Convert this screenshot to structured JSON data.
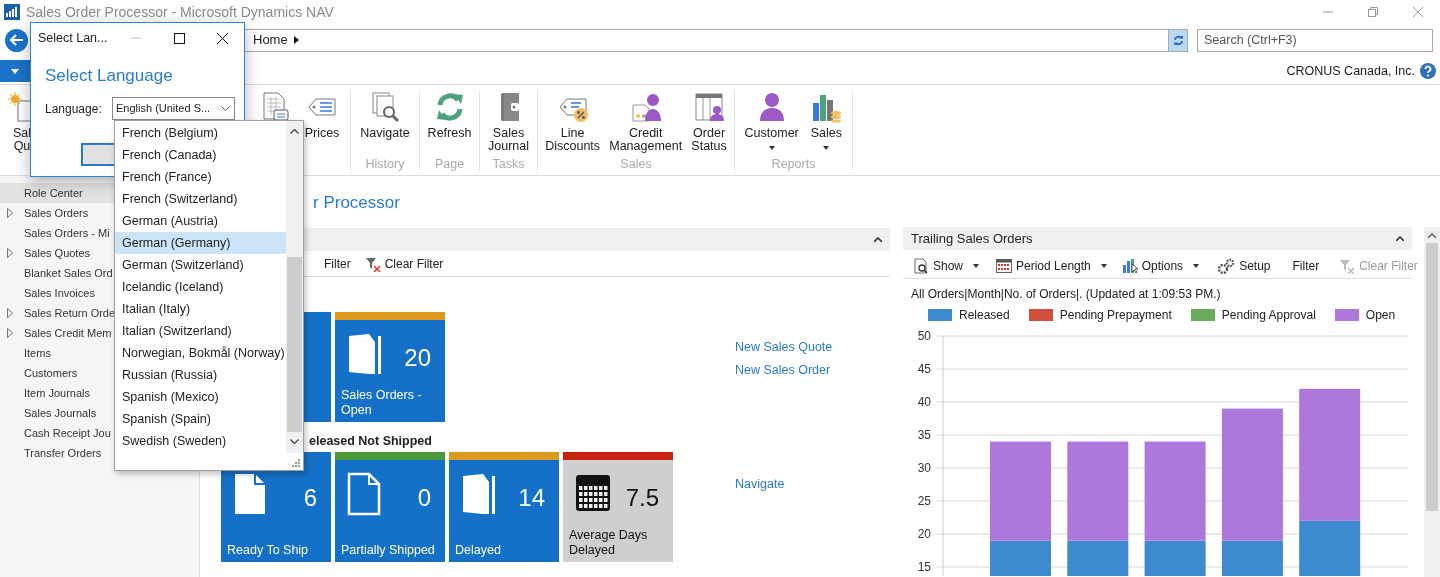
{
  "window": {
    "title": "Sales Order Processor - Microsoft Dynamics NAV"
  },
  "address_bar": {
    "breadcrumb": "Home",
    "search": {
      "placeholder": "Search (Ctrl+F3)"
    }
  },
  "company": "CRONUS Canada, Inc.",
  "ribbon": {
    "groups": [
      {
        "items": [
          {
            "label": "Sal Qu",
            "dropdown": false
          },
          {
            "dropdown": false
          },
          {
            "label": "Prices",
            "dropdown": false
          }
        ]
      },
      {
        "label": "History",
        "items": [
          {
            "label": "Navigate",
            "dropdown": false
          }
        ]
      },
      {
        "label": "Page",
        "items": [
          {
            "label": "Refresh",
            "dropdown": false
          }
        ]
      },
      {
        "label": "Tasks",
        "items": [
          {
            "label": "Sales Journal",
            "dropdown": false
          }
        ]
      },
      {
        "label": "Sales",
        "items": [
          {
            "label": "Line Discounts",
            "dropdown": false
          },
          {
            "label": "Credit Management",
            "dropdown": false
          },
          {
            "label": "Order Status",
            "dropdown": false
          }
        ]
      },
      {
        "label": "Reports",
        "items": [
          {
            "label": "Customer",
            "dropdown": true
          },
          {
            "label": "Sales",
            "dropdown": true
          }
        ]
      }
    ]
  },
  "sidebar": {
    "items": [
      {
        "label": "Role Center",
        "expandable": false,
        "selected": true
      },
      {
        "label": "Sales Orders",
        "expandable": true,
        "selected": false
      },
      {
        "label": "Sales Orders - Mi",
        "expandable": false,
        "selected": false
      },
      {
        "label": "Sales Quotes",
        "expandable": true,
        "selected": false
      },
      {
        "label": "Blanket Sales Ord",
        "expandable": false,
        "selected": false
      },
      {
        "label": "Sales Invoices",
        "expandable": false,
        "selected": false
      },
      {
        "label": "Sales Return Orde",
        "expandable": true,
        "selected": false
      },
      {
        "label": "Sales Credit Mem",
        "expandable": true,
        "selected": false
      },
      {
        "label": "Items",
        "expandable": false,
        "selected": false
      },
      {
        "label": "Customers",
        "expandable": false,
        "selected": false
      },
      {
        "label": "Item Journals",
        "expandable": false,
        "selected": false
      },
      {
        "label": "Sales Journals",
        "expandable": false,
        "selected": false
      },
      {
        "label": "Cash Receipt Jou",
        "expandable": false,
        "selected": false
      },
      {
        "label": "Transfer Orders",
        "expandable": false,
        "selected": false
      }
    ]
  },
  "activities": {
    "title": "r Processor",
    "toolbar": [
      {
        "label": "Filter",
        "disabled": false
      },
      {
        "label": "Clear Filter",
        "disabled": false
      }
    ],
    "rows": [
      {
        "tiles": [
          {
            "kind": "blue"
          },
          {
            "kind": "blue",
            "value": "20",
            "label": "Sales Orders - Open",
            "color": "#dd9a1e"
          }
        ],
        "links": [
          "New Sales Quote",
          "New Sales Order"
        ]
      },
      {
        "heading": "eleased Not Shipped",
        "tiles": [
          {
            "kind": "blue",
            "value": "6",
            "label": "Ready To Ship"
          },
          {
            "kind": "blue",
            "value": "0",
            "label": "Partially Shipped",
            "color": "#4a9a3c"
          },
          {
            "kind": "blue",
            "value": "14",
            "label": "Delayed",
            "color": "#dd9a1e"
          },
          {
            "kind": "grey",
            "value": "7.5",
            "label": "Average Days Delayed",
            "color": "#c8230f"
          }
        ],
        "links": [
          "Navigate"
        ]
      }
    ]
  },
  "trailing_sales_orders": {
    "title": "Trailing Sales Orders",
    "toolbar": [
      {
        "label": "Show",
        "dropdown": true,
        "disabled": false
      },
      {
        "label": "Period Length",
        "dropdown": true,
        "disabled": false
      },
      {
        "label": "Options",
        "dropdown": true,
        "disabled": false
      },
      {
        "label": "Setup",
        "dropdown": false,
        "disabled": false
      },
      {
        "label": "Filter",
        "dropdown": false,
        "disabled": false
      },
      {
        "label": "Clear Filter",
        "dropdown": false,
        "disabled": true
      }
    ],
    "info": "All Orders|Month|No. of Orders|. (Updated at  1:09:53 PM.)",
    "chart_data": {
      "type": "bar",
      "stacked": true,
      "grid": true,
      "ylim": [
        15,
        50
      ],
      "yticks": [
        15,
        20,
        25,
        30,
        35,
        40,
        45,
        50
      ],
      "series": [
        {
          "name": "Released",
          "color": "#3d8ad1",
          "values": [
            19,
            19,
            19,
            19,
            22
          ]
        },
        {
          "name": "Pending Prepayment",
          "color": "#d04e3c",
          "values": [
            null,
            null,
            null,
            null,
            null
          ]
        },
        {
          "name": "Pending Approval",
          "color": "#6aaa5c",
          "values": [
            null,
            null,
            null,
            null,
            null
          ]
        },
        {
          "name": "Open",
          "color": "#ad77db",
          "values": [
            15,
            15,
            15,
            20,
            20
          ]
        }
      ]
    }
  },
  "dialog": {
    "title": "Select Lan...",
    "heading": "Select Language",
    "language_label": "Language:",
    "language_value": "English (United S...",
    "options": [
      {
        "label": "French (Belgium)",
        "selected": false
      },
      {
        "label": "French (Canada)",
        "selected": false
      },
      {
        "label": "French (France)",
        "selected": false
      },
      {
        "label": "French (Switzerland)",
        "selected": false
      },
      {
        "label": "German (Austria)",
        "selected": false
      },
      {
        "label": "German (Germany)",
        "selected": true
      },
      {
        "label": "German (Switzerland)",
        "selected": false
      },
      {
        "label": "Icelandic (Iceland)",
        "selected": false
      },
      {
        "label": "Italian (Italy)",
        "selected": false
      },
      {
        "label": "Italian (Switzerland)",
        "selected": false
      },
      {
        "label": "Norwegian, Bokmål (Norway)",
        "selected": false
      },
      {
        "label": "Russian (Russia)",
        "selected": false
      },
      {
        "label": "Spanish (Mexico)",
        "selected": false
      },
      {
        "label": "Spanish (Spain)",
        "selected": false
      },
      {
        "label": "Swedish (Sweden)",
        "selected": false
      }
    ]
  }
}
